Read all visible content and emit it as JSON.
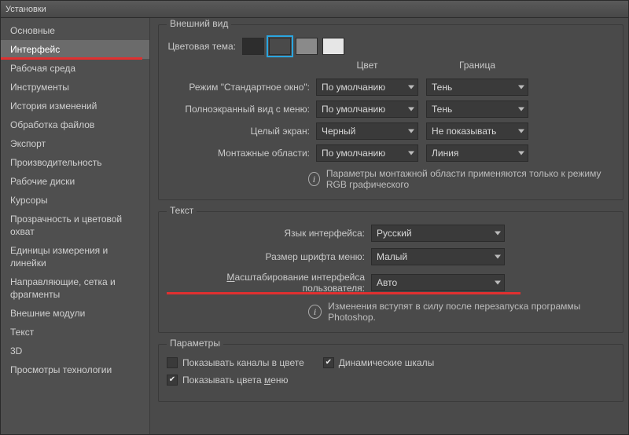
{
  "window": {
    "title": "Установки"
  },
  "sidebar": {
    "items": [
      {
        "label": "Основные"
      },
      {
        "label": "Интерфейс"
      },
      {
        "label": "Рабочая среда"
      },
      {
        "label": "Инструменты"
      },
      {
        "label": "История изменений"
      },
      {
        "label": "Обработка файлов"
      },
      {
        "label": "Экспорт"
      },
      {
        "label": "Производительность"
      },
      {
        "label": "Рабочие диски"
      },
      {
        "label": "Курсоры"
      },
      {
        "label": "Прозрачность и цветовой охват"
      },
      {
        "label": "Единицы измерения и линейки"
      },
      {
        "label": "Направляющие, сетка и фрагменты"
      },
      {
        "label": "Внешние модули"
      },
      {
        "label": "Текст"
      },
      {
        "label": "3D"
      },
      {
        "label": "Просмотры технологии"
      }
    ],
    "activeIndex": 1
  },
  "appearance": {
    "group_title": "Внешний вид",
    "color_theme_label": "Цветовая тема:",
    "col_color": "Цвет",
    "col_border": "Граница",
    "rows": {
      "standard": {
        "label": "Режим \"Стандартное окно\":",
        "color": "По умолчанию",
        "border": "Тень"
      },
      "fullscreen": {
        "label": "Полноэкранный вид с меню:",
        "color": "По умолчанию",
        "border": "Тень"
      },
      "full": {
        "label": "Целый экран:",
        "color": "Черный",
        "border": "Не показывать"
      },
      "artboard": {
        "label": "Монтажные области:",
        "color": "По умолчанию",
        "border": "Линия"
      }
    },
    "info": "Параметры монтажной области применяются только к режиму RGB графического"
  },
  "text": {
    "group_title": "Текст",
    "lang_label": "Язык интерфейса:",
    "lang_value": "Русский",
    "fontsize_label": "Размер шрифта меню:",
    "fontsize_value": "Малый",
    "scale_label_pre": "М",
    "scale_label_rest": "асштабирование интерфейса пользователя:",
    "scale_value": "Авто",
    "info": "Изменения вступят в силу после перезапуска программы Photoshop."
  },
  "options": {
    "group_title": "Параметры",
    "show_channels_color": "Показывать каналы в цвете",
    "dynamic_scales": "Динамические шкалы",
    "show_menu_colors_pre": "Показывать цвета ",
    "show_menu_colors_under": "м",
    "show_menu_colors_post": "еню"
  }
}
